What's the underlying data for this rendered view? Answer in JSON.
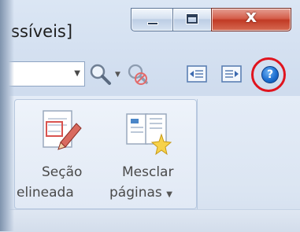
{
  "window": {
    "title": "ssíveis]",
    "minimize_label": "Minimize",
    "maximize_label": "Maximize",
    "close_glyph": "x"
  },
  "toolbar": {
    "help_glyph": "?"
  },
  "ribbon": {
    "section_line1": "Seção",
    "section_line2": "elineada",
    "merge_line1": "Mesclar",
    "merge_line2": "páginas"
  },
  "colors": {
    "highlight_ring": "#e0141e",
    "close_button": "#c13a25",
    "help_button": "#1d6fd1"
  }
}
